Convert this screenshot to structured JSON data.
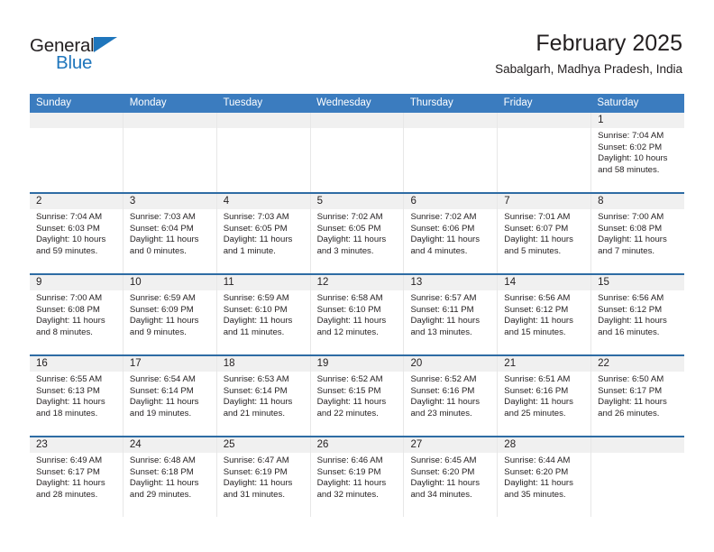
{
  "brand": {
    "name_top": "General",
    "name_bottom": "Blue",
    "accent_color": "#1f76bc",
    "triangle_icon": "brand-triangle-icon"
  },
  "header": {
    "title": "February 2025",
    "subtitle": "Sabalgarh, Madhya Pradesh, India"
  },
  "colors": {
    "header_row_bg": "#3b7cbf",
    "row_divider": "#2e6ca4",
    "day_number_band": "#f0f0f0",
    "text": "#231f20"
  },
  "weekday_headers": [
    "Sunday",
    "Monday",
    "Tuesday",
    "Wednesday",
    "Thursday",
    "Friday",
    "Saturday"
  ],
  "labels": {
    "sunrise_prefix": "Sunrise:",
    "sunset_prefix": "Sunset:",
    "daylight_prefix": "Daylight:"
  },
  "weeks": [
    [
      {
        "day": "",
        "empty": true
      },
      {
        "day": "",
        "empty": true
      },
      {
        "day": "",
        "empty": true
      },
      {
        "day": "",
        "empty": true
      },
      {
        "day": "",
        "empty": true
      },
      {
        "day": "",
        "empty": true
      },
      {
        "day": "1",
        "sunrise": "Sunrise: 7:04 AM",
        "sunset": "Sunset: 6:02 PM",
        "daylight": "Daylight: 10 hours and 58 minutes."
      }
    ],
    [
      {
        "day": "2",
        "sunrise": "Sunrise: 7:04 AM",
        "sunset": "Sunset: 6:03 PM",
        "daylight": "Daylight: 10 hours and 59 minutes."
      },
      {
        "day": "3",
        "sunrise": "Sunrise: 7:03 AM",
        "sunset": "Sunset: 6:04 PM",
        "daylight": "Daylight: 11 hours and 0 minutes."
      },
      {
        "day": "4",
        "sunrise": "Sunrise: 7:03 AM",
        "sunset": "Sunset: 6:05 PM",
        "daylight": "Daylight: 11 hours and 1 minute."
      },
      {
        "day": "5",
        "sunrise": "Sunrise: 7:02 AM",
        "sunset": "Sunset: 6:05 PM",
        "daylight": "Daylight: 11 hours and 3 minutes."
      },
      {
        "day": "6",
        "sunrise": "Sunrise: 7:02 AM",
        "sunset": "Sunset: 6:06 PM",
        "daylight": "Daylight: 11 hours and 4 minutes."
      },
      {
        "day": "7",
        "sunrise": "Sunrise: 7:01 AM",
        "sunset": "Sunset: 6:07 PM",
        "daylight": "Daylight: 11 hours and 5 minutes."
      },
      {
        "day": "8",
        "sunrise": "Sunrise: 7:00 AM",
        "sunset": "Sunset: 6:08 PM",
        "daylight": "Daylight: 11 hours and 7 minutes."
      }
    ],
    [
      {
        "day": "9",
        "sunrise": "Sunrise: 7:00 AM",
        "sunset": "Sunset: 6:08 PM",
        "daylight": "Daylight: 11 hours and 8 minutes."
      },
      {
        "day": "10",
        "sunrise": "Sunrise: 6:59 AM",
        "sunset": "Sunset: 6:09 PM",
        "daylight": "Daylight: 11 hours and 9 minutes."
      },
      {
        "day": "11",
        "sunrise": "Sunrise: 6:59 AM",
        "sunset": "Sunset: 6:10 PM",
        "daylight": "Daylight: 11 hours and 11 minutes."
      },
      {
        "day": "12",
        "sunrise": "Sunrise: 6:58 AM",
        "sunset": "Sunset: 6:10 PM",
        "daylight": "Daylight: 11 hours and 12 minutes."
      },
      {
        "day": "13",
        "sunrise": "Sunrise: 6:57 AM",
        "sunset": "Sunset: 6:11 PM",
        "daylight": "Daylight: 11 hours and 13 minutes."
      },
      {
        "day": "14",
        "sunrise": "Sunrise: 6:56 AM",
        "sunset": "Sunset: 6:12 PM",
        "daylight": "Daylight: 11 hours and 15 minutes."
      },
      {
        "day": "15",
        "sunrise": "Sunrise: 6:56 AM",
        "sunset": "Sunset: 6:12 PM",
        "daylight": "Daylight: 11 hours and 16 minutes."
      }
    ],
    [
      {
        "day": "16",
        "sunrise": "Sunrise: 6:55 AM",
        "sunset": "Sunset: 6:13 PM",
        "daylight": "Daylight: 11 hours and 18 minutes."
      },
      {
        "day": "17",
        "sunrise": "Sunrise: 6:54 AM",
        "sunset": "Sunset: 6:14 PM",
        "daylight": "Daylight: 11 hours and 19 minutes."
      },
      {
        "day": "18",
        "sunrise": "Sunrise: 6:53 AM",
        "sunset": "Sunset: 6:14 PM",
        "daylight": "Daylight: 11 hours and 21 minutes."
      },
      {
        "day": "19",
        "sunrise": "Sunrise: 6:52 AM",
        "sunset": "Sunset: 6:15 PM",
        "daylight": "Daylight: 11 hours and 22 minutes."
      },
      {
        "day": "20",
        "sunrise": "Sunrise: 6:52 AM",
        "sunset": "Sunset: 6:16 PM",
        "daylight": "Daylight: 11 hours and 23 minutes."
      },
      {
        "day": "21",
        "sunrise": "Sunrise: 6:51 AM",
        "sunset": "Sunset: 6:16 PM",
        "daylight": "Daylight: 11 hours and 25 minutes."
      },
      {
        "day": "22",
        "sunrise": "Sunrise: 6:50 AM",
        "sunset": "Sunset: 6:17 PM",
        "daylight": "Daylight: 11 hours and 26 minutes."
      }
    ],
    [
      {
        "day": "23",
        "sunrise": "Sunrise: 6:49 AM",
        "sunset": "Sunset: 6:17 PM",
        "daylight": "Daylight: 11 hours and 28 minutes."
      },
      {
        "day": "24",
        "sunrise": "Sunrise: 6:48 AM",
        "sunset": "Sunset: 6:18 PM",
        "daylight": "Daylight: 11 hours and 29 minutes."
      },
      {
        "day": "25",
        "sunrise": "Sunrise: 6:47 AM",
        "sunset": "Sunset: 6:19 PM",
        "daylight": "Daylight: 11 hours and 31 minutes."
      },
      {
        "day": "26",
        "sunrise": "Sunrise: 6:46 AM",
        "sunset": "Sunset: 6:19 PM",
        "daylight": "Daylight: 11 hours and 32 minutes."
      },
      {
        "day": "27",
        "sunrise": "Sunrise: 6:45 AM",
        "sunset": "Sunset: 6:20 PM",
        "daylight": "Daylight: 11 hours and 34 minutes."
      },
      {
        "day": "28",
        "sunrise": "Sunrise: 6:44 AM",
        "sunset": "Sunset: 6:20 PM",
        "daylight": "Daylight: 11 hours and 35 minutes."
      },
      {
        "day": "",
        "empty": true
      }
    ]
  ]
}
